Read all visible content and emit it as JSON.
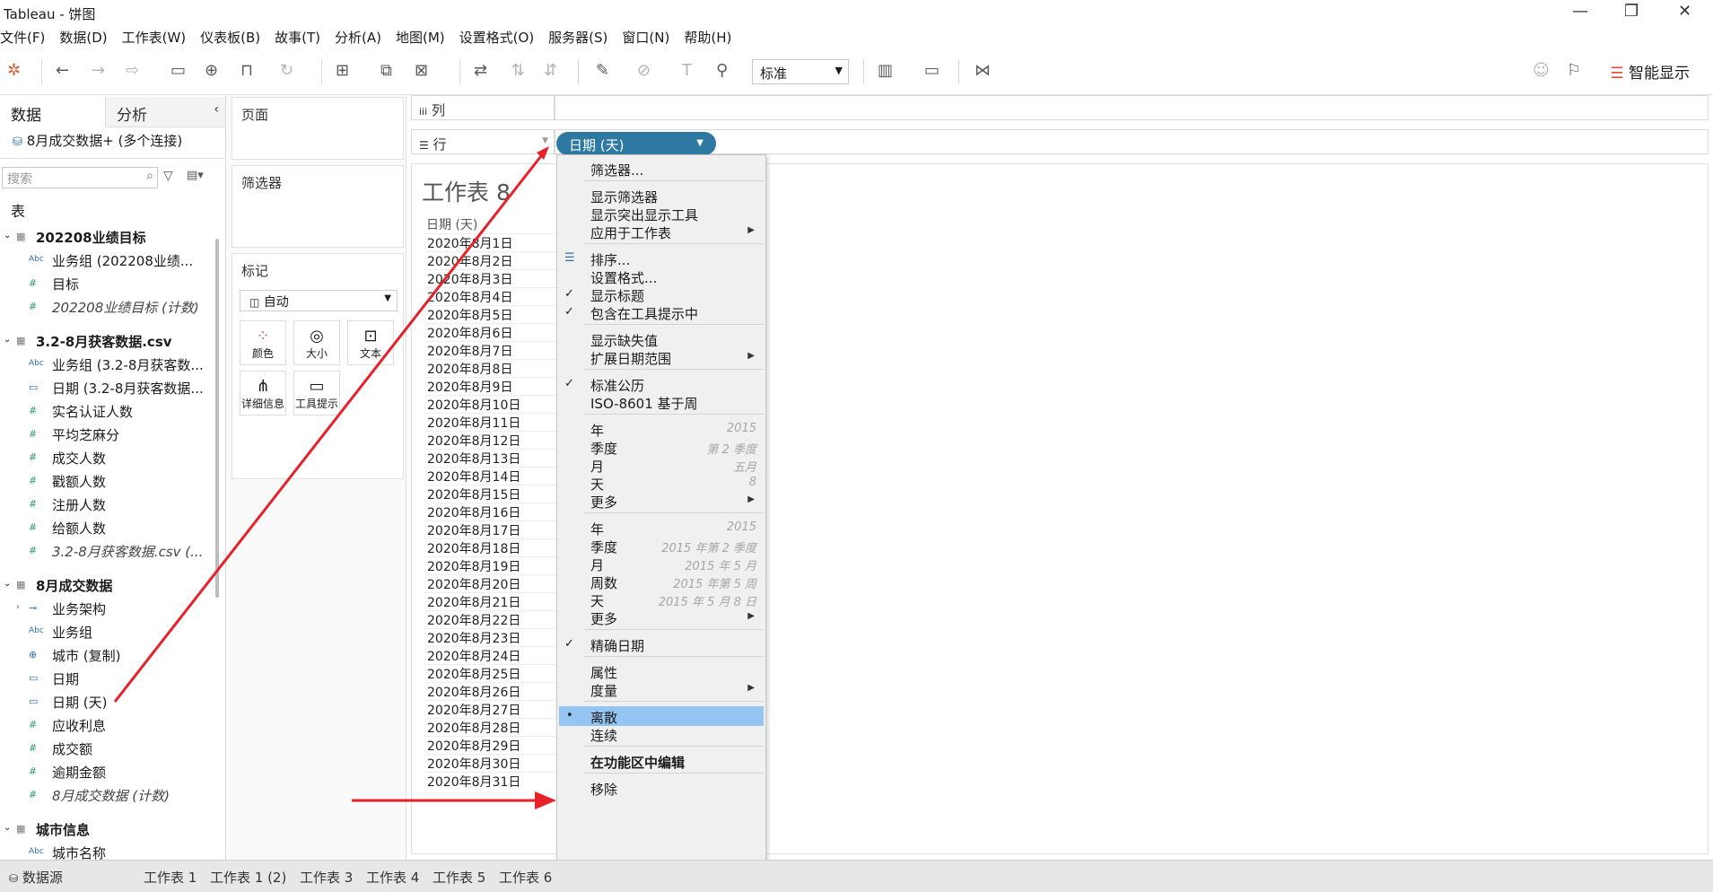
{
  "window": {
    "title": "Tableau - 饼图",
    "min": "—",
    "max": "❐",
    "close": "✕"
  },
  "menu": [
    "文件(F)",
    "数据(D)",
    "工作表(W)",
    "仪表板(B)",
    "故事(T)",
    "分析(A)",
    "地图(M)",
    "设置格式(O)",
    "服务器(S)",
    "窗口(N)",
    "帮助(H)"
  ],
  "toolbar": {
    "fit_select": "标准",
    "smart_show": "智能显示"
  },
  "left_pane": {
    "tab_data": "数据",
    "tab_analysis": "分析",
    "datasource": "8月成交数据+ (多个连接)",
    "search_placeholder": "搜索",
    "tables_label": "表",
    "groups": [
      {
        "name": "202208业绩目标",
        "items": [
          {
            "type": "abc",
            "label": "业务组 (202208业绩..."
          },
          {
            "type": "num",
            "label": "目标"
          },
          {
            "type": "num",
            "label": "202208业绩目标 (计数)",
            "italic": true
          }
        ]
      },
      {
        "name": "3.2-8月获客数据.csv",
        "items": [
          {
            "type": "abc",
            "label": "业务组 (3.2-8月获客数..."
          },
          {
            "type": "date",
            "label": "日期 (3.2-8月获客数据..."
          },
          {
            "type": "num",
            "label": "实名认证人数"
          },
          {
            "type": "num",
            "label": "平均芝麻分"
          },
          {
            "type": "num",
            "label": "成交人数"
          },
          {
            "type": "num",
            "label": "戳额人数"
          },
          {
            "type": "num",
            "label": "注册人数"
          },
          {
            "type": "num",
            "label": "给额人数"
          },
          {
            "type": "num",
            "label": "3.2-8月获客数据.csv (...",
            "italic": true
          }
        ]
      },
      {
        "name": "8月成交数据",
        "items": [
          {
            "type": "hier",
            "label": "业务架构"
          },
          {
            "type": "abc",
            "label": "业务组"
          },
          {
            "type": "geo",
            "label": "城市 (复制)"
          },
          {
            "type": "date",
            "label": "日期"
          },
          {
            "type": "date",
            "label": "日期 (天)"
          },
          {
            "type": "num",
            "label": "应收利息"
          },
          {
            "type": "num",
            "label": "成交额"
          },
          {
            "type": "num",
            "label": "逾期金额"
          },
          {
            "type": "num",
            "label": "8月成交数据 (计数)",
            "italic": true
          }
        ]
      },
      {
        "name": "城市信息",
        "items": [
          {
            "type": "abc",
            "label": "城市名称"
          }
        ]
      }
    ]
  },
  "cards": {
    "pages": "页面",
    "filters": "筛选器",
    "marks": "标记",
    "marks_type": "自动",
    "mark_buttons": [
      "颜色",
      "大小",
      "文本",
      "详细信息",
      "工具提示"
    ]
  },
  "shelves": {
    "columns": "列",
    "rows": "行",
    "pill": "日期 (天)"
  },
  "view": {
    "title": "工作表 8",
    "col_header": "日期 (天)",
    "dates": [
      "2020年8月1日",
      "2020年8月2日",
      "2020年8月3日",
      "2020年8月4日",
      "2020年8月5日",
      "2020年8月6日",
      "2020年8月7日",
      "2020年8月8日",
      "2020年8月9日",
      "2020年8月10日",
      "2020年8月11日",
      "2020年8月12日",
      "2020年8月13日",
      "2020年8月14日",
      "2020年8月15日",
      "2020年8月16日",
      "2020年8月17日",
      "2020年8月18日",
      "2020年8月19日",
      "2020年8月20日",
      "2020年8月21日",
      "2020年8月22日",
      "2020年8月23日",
      "2020年8月24日",
      "2020年8月25日",
      "2020年8月26日",
      "2020年8月27日",
      "2020年8月28日",
      "2020年8月29日",
      "2020年8月30日",
      "2020年8月31日"
    ]
  },
  "context_menu": {
    "filter": "筛选器...",
    "show_filter": "显示筛选器",
    "show_highlighter": "显示突出显示工具",
    "apply_to": "应用于工作表",
    "sort": "排序...",
    "format": "设置格式...",
    "show_header": "显示标题",
    "include_tooltip": "包含在工具提示中",
    "show_missing": "显示缺失值",
    "extend_range": "扩展日期范围",
    "std_calendar": "标准公历",
    "iso_week": "ISO-8601 基于周",
    "part_year": "年",
    "part_year_ex": "2015",
    "part_quarter": "季度",
    "part_quarter_ex": "第 2 季度",
    "part_month": "月",
    "part_month_ex": "五月",
    "part_day": "天",
    "part_day_ex": "8",
    "part_more": "更多",
    "val_year": "年",
    "val_year_ex": "2015",
    "val_quarter": "季度",
    "val_quarter_ex": "2015 年第 2 季度",
    "val_month": "月",
    "val_month_ex": "2015 年 5 月",
    "val_week": "周数",
    "val_week_ex": "2015 年第 5 周",
    "val_day": "天",
    "val_day_ex": "2015 年 5 月 8 日",
    "val_more": "更多",
    "exact_date": "精确日期",
    "attribute": "属性",
    "measure": "度量",
    "discrete": "离散",
    "continuous": "连续",
    "edit_shelf": "在功能区中编辑",
    "remove": "移除"
  },
  "bottom_tabs": {
    "datasource": "数据源",
    "sheets": [
      "工作表 1",
      "工作表 1 (2)",
      "工作表 3",
      "工作表 4",
      "工作表 5",
      "工作表 6"
    ]
  },
  "annotation_color": "#e8202a",
  "highlight_color": "#95c5f2",
  "pill_color": "#2e79a1"
}
